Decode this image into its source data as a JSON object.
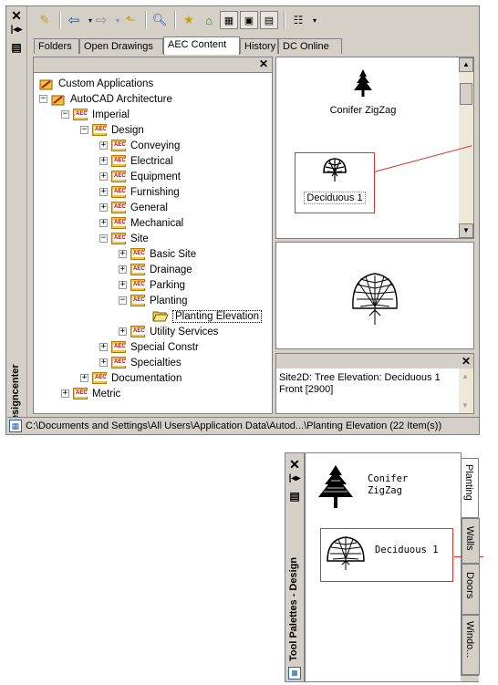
{
  "design_center": {
    "title": "Designcenter",
    "tabs": [
      "Folders",
      "Open Drawings",
      "AEC Content",
      "History",
      "DC Online"
    ],
    "tree": {
      "close_glyph": "✕",
      "nodes": [
        {
          "label": "Custom Applications"
        },
        {
          "label": "AutoCAD Architecture"
        },
        {
          "label": "Imperial"
        },
        {
          "label": "Design"
        },
        {
          "label": "Conveying"
        },
        {
          "label": "Electrical"
        },
        {
          "label": "Equipment"
        },
        {
          "label": "Furnishing"
        },
        {
          "label": "General"
        },
        {
          "label": "Mechanical"
        },
        {
          "label": "Site"
        },
        {
          "label": "Basic Site"
        },
        {
          "label": "Drainage"
        },
        {
          "label": "Parking"
        },
        {
          "label": "Planting"
        },
        {
          "label": "Planting Elevation"
        },
        {
          "label": "Utility Services"
        },
        {
          "label": "Special Constr"
        },
        {
          "label": "Specialties"
        },
        {
          "label": "Documentation"
        },
        {
          "label": "Metric"
        }
      ]
    },
    "palette_items": [
      {
        "label": "Conifer ZigZag",
        "icon": "conifer-tree-icon"
      },
      {
        "label": "Deciduous 1",
        "icon": "deciduous-tree-icon"
      }
    ],
    "description": "Site2D: Tree Elevation: Deciduous 1 Front [2900]",
    "status": "C:\\Documents and Settings\\All Users\\Application Data\\Autod...\\Planting Elevation (22 Item(s))"
  },
  "tool_palette": {
    "title": "Tool Palettes - Design",
    "items": [
      {
        "label": "Conifer ZigZag",
        "icon": "conifer-tree-icon"
      },
      {
        "label": "Deciduous 1",
        "icon": "deciduous-tree-icon"
      }
    ],
    "tabs": [
      "Planting",
      "Walls",
      "Doors",
      "Windo..."
    ]
  },
  "colors": {
    "callout": "#e03030",
    "chrome": "#d4d0c8",
    "aec_folder": "#f2c23c"
  }
}
